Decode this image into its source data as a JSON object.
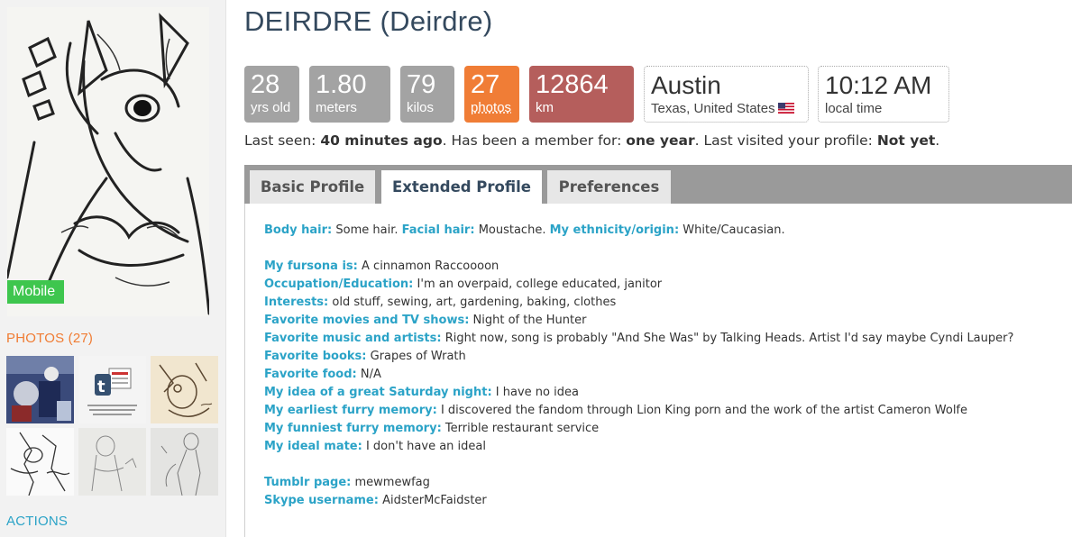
{
  "profile": {
    "name": "DEIRDRE (Deirdre)",
    "mobile_badge": "Mobile"
  },
  "sidebar": {
    "photos_heading": "PHOTOS (27)",
    "actions_heading": "ACTIONS"
  },
  "stats": {
    "age": {
      "value": "28",
      "unit": "yrs old"
    },
    "height": {
      "value": "1.80",
      "unit": "meters"
    },
    "weight": {
      "value": "79",
      "unit": "kilos"
    },
    "photos": {
      "value": "27",
      "unit": "photos"
    },
    "distance": {
      "value": "12864",
      "unit": "km"
    },
    "location": {
      "city": "Austin",
      "region": "Texas, United States"
    },
    "time": {
      "value": "10:12 AM",
      "unit": "local time"
    }
  },
  "last_seen": {
    "seen_label": "Last seen: ",
    "seen_value": "40 minutes ago",
    "member_label": ". Has been a member for: ",
    "member_value": "one year",
    "visited_label": ". Last visited your profile: ",
    "visited_value": "Not yet",
    "end": "."
  },
  "tabs": [
    {
      "label": "Basic Profile"
    },
    {
      "label": "Extended Profile"
    },
    {
      "label": "Preferences"
    }
  ],
  "extended": {
    "body_hair": {
      "label": "Body hair:",
      "value": "Some hair."
    },
    "facial_hair": {
      "label": "Facial hair:",
      "value": "Moustache."
    },
    "ethnicity": {
      "label": "My ethnicity/origin:",
      "value": "White/Caucasian."
    },
    "fursona": {
      "label": "My fursona is:",
      "value": "A cinnamon Raccoooon"
    },
    "occupation": {
      "label": "Occupation/Education:",
      "value": "I'm an overpaid, college educated, janitor"
    },
    "interests": {
      "label": "Interests:",
      "value": "old stuff, sewing, art, gardening, baking, clothes"
    },
    "movies": {
      "label": "Favorite movies and TV shows:",
      "value": "Night of the Hunter"
    },
    "music": {
      "label": "Favorite music and artists:",
      "value": "Right now, song is probably \"And She Was\" by Talking Heads. Artist I'd say maybe Cyndi Lauper?"
    },
    "books": {
      "label": "Favorite books:",
      "value": "Grapes of Wrath"
    },
    "food": {
      "label": "Favorite food:",
      "value": "N/A"
    },
    "saturday": {
      "label": "My idea of a great Saturday night:",
      "value": "I have no idea"
    },
    "earliest": {
      "label": "My earliest furry memory:",
      "value": "I discovered the fandom through Lion King porn and the work of the artist Cameron Wolfe"
    },
    "funniest": {
      "label": "My funniest furry memory:",
      "value": "Terrible restaurant service"
    },
    "ideal_mate": {
      "label": "My ideal mate:",
      "value": "I don't have an ideal"
    },
    "tumblr": {
      "label": "Tumblr page:",
      "value": "mewmewfag"
    },
    "skype": {
      "label": "Skype username:",
      "value": "AidsterMcFaidster"
    }
  },
  "colors": {
    "stat_gray": "#a3a3a3",
    "stat_orange": "#f07d36",
    "stat_red": "#b55e5c",
    "label_blue": "#2ba3c7",
    "mobile_green": "#3ec64e",
    "photos_orange": "#f07c33"
  }
}
